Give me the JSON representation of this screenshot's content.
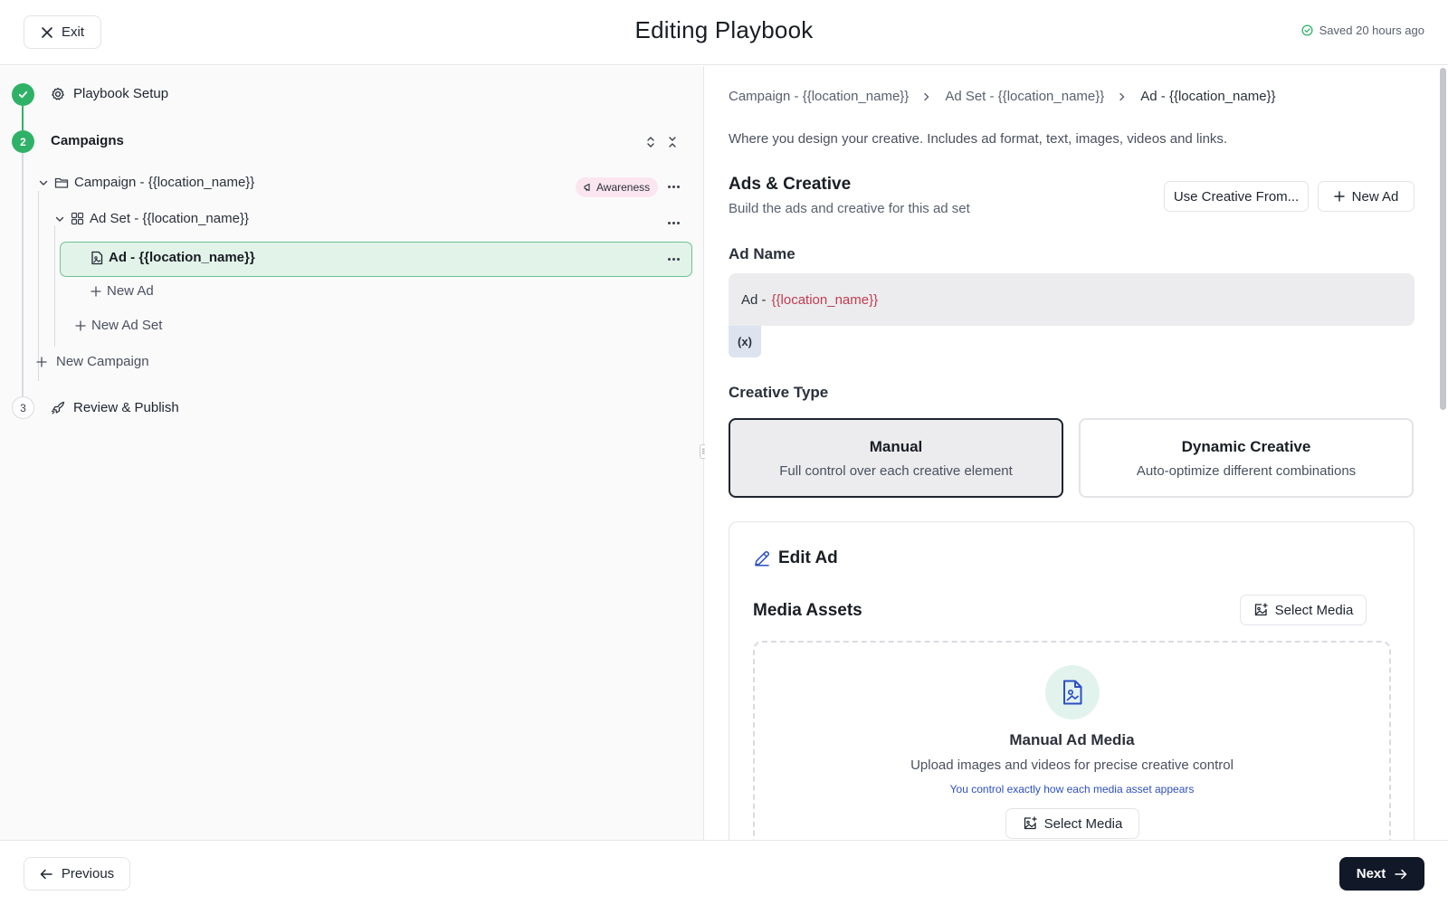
{
  "header": {
    "exit_label": "Exit",
    "title": "Editing Playbook",
    "saved_text": "Saved 20 hours ago"
  },
  "steps": {
    "setup": {
      "number": "",
      "label": "Playbook Setup",
      "status": "done"
    },
    "campaigns": {
      "number": "2",
      "label": "Campaigns",
      "status": "active"
    },
    "review": {
      "number": "3",
      "label": "Review & Publish",
      "status": "pending"
    }
  },
  "tree": {
    "campaign": {
      "label": "Campaign - {{location_name}}",
      "badge": "Awareness"
    },
    "adset": {
      "label": "Ad Set - {{location_name}}"
    },
    "ad": {
      "label": "Ad - {{location_name}}"
    },
    "new_ad": "New Ad",
    "new_adset": "New Ad Set",
    "new_campaign": "New Campaign"
  },
  "breadcrumb": [
    "Campaign - {{location_name}}",
    "Ad Set - {{location_name}}",
    "Ad - {{location_name}}"
  ],
  "main": {
    "description": "Where you design your creative. Includes ad format, text, images, videos and links.",
    "section_title": "Ads & Creative",
    "section_subtitle": "Build the ads and creative for this ad set",
    "use_creative_label": "Use Creative From...",
    "new_ad_label": "New Ad",
    "ad_name_label": "Ad Name",
    "ad_name_prefix": "Ad -",
    "ad_name_variable": "{{location_name}}",
    "variable_button": "(x)",
    "creative_type_label": "Creative Type",
    "creative_types": [
      {
        "title": "Manual",
        "subtitle": "Full control over each creative element",
        "selected": true
      },
      {
        "title": "Dynamic Creative",
        "subtitle": "Auto-optimize different combinations",
        "selected": false
      }
    ],
    "edit_ad_title": "Edit Ad",
    "media_assets_title": "Media Assets",
    "select_media_label": "Select Media",
    "dropzone": {
      "title": "Manual Ad Media",
      "subtitle": "Upload images and videos for precise creative control",
      "note": "You control exactly how each media asset appears",
      "button": "Select Media"
    }
  },
  "footer": {
    "previous_label": "Previous",
    "next_label": "Next"
  },
  "colors": {
    "accent_green": "#2fb267",
    "selected_row_bg": "#e2f3e9",
    "variable_red": "#c23a4f",
    "link_blue": "#2c4fc4",
    "primary_dark": "#111827"
  }
}
